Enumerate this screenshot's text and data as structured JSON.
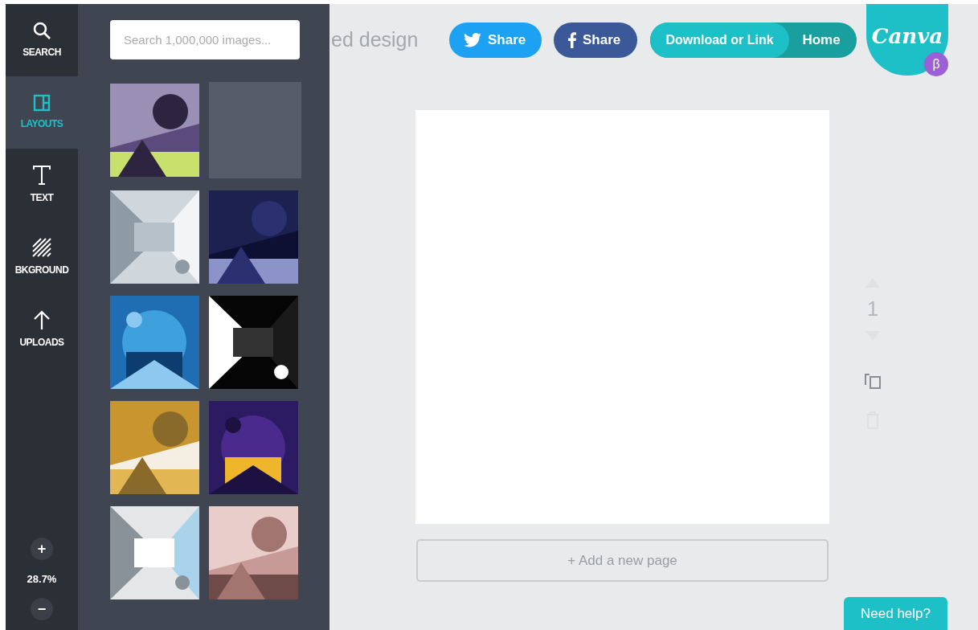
{
  "sidebar": {
    "items": [
      {
        "kind": "search",
        "label": "SEARCH",
        "selected": false
      },
      {
        "kind": "layouts",
        "label": "LAYOUTS",
        "selected": true
      },
      {
        "kind": "text",
        "label": "TEXT",
        "selected": false
      },
      {
        "kind": "background",
        "label": "BKGROUND",
        "selected": false
      },
      {
        "kind": "uploads",
        "label": "UPLOADS",
        "selected": false
      }
    ],
    "zoom": {
      "zoom_in": "+",
      "value": "28.7%",
      "zoom_out": "−"
    }
  },
  "panel": {
    "search": {
      "placeholder": "Search 1,000,000 images..."
    },
    "layouts": [
      {
        "kind": "picture"
      },
      {
        "kind": "placeholder"
      },
      {
        "kind": "picture"
      },
      {
        "kind": "picture"
      },
      {
        "kind": "picture"
      },
      {
        "kind": "picture"
      },
      {
        "kind": "picture"
      },
      {
        "kind": "picture"
      },
      {
        "kind": "picture"
      },
      {
        "kind": "picture"
      }
    ]
  },
  "header": {
    "title": "ed design",
    "share_buttons": [
      {
        "kind": "twitter",
        "label": "Share"
      },
      {
        "kind": "facebook",
        "label": "Share"
      }
    ],
    "download": "Download or Link",
    "home": "Home",
    "logo": "Canva",
    "beta": "β"
  },
  "page_controls": {
    "page_number": "1"
  },
  "add_page": "+ Add a new page",
  "help": "Need help?"
}
